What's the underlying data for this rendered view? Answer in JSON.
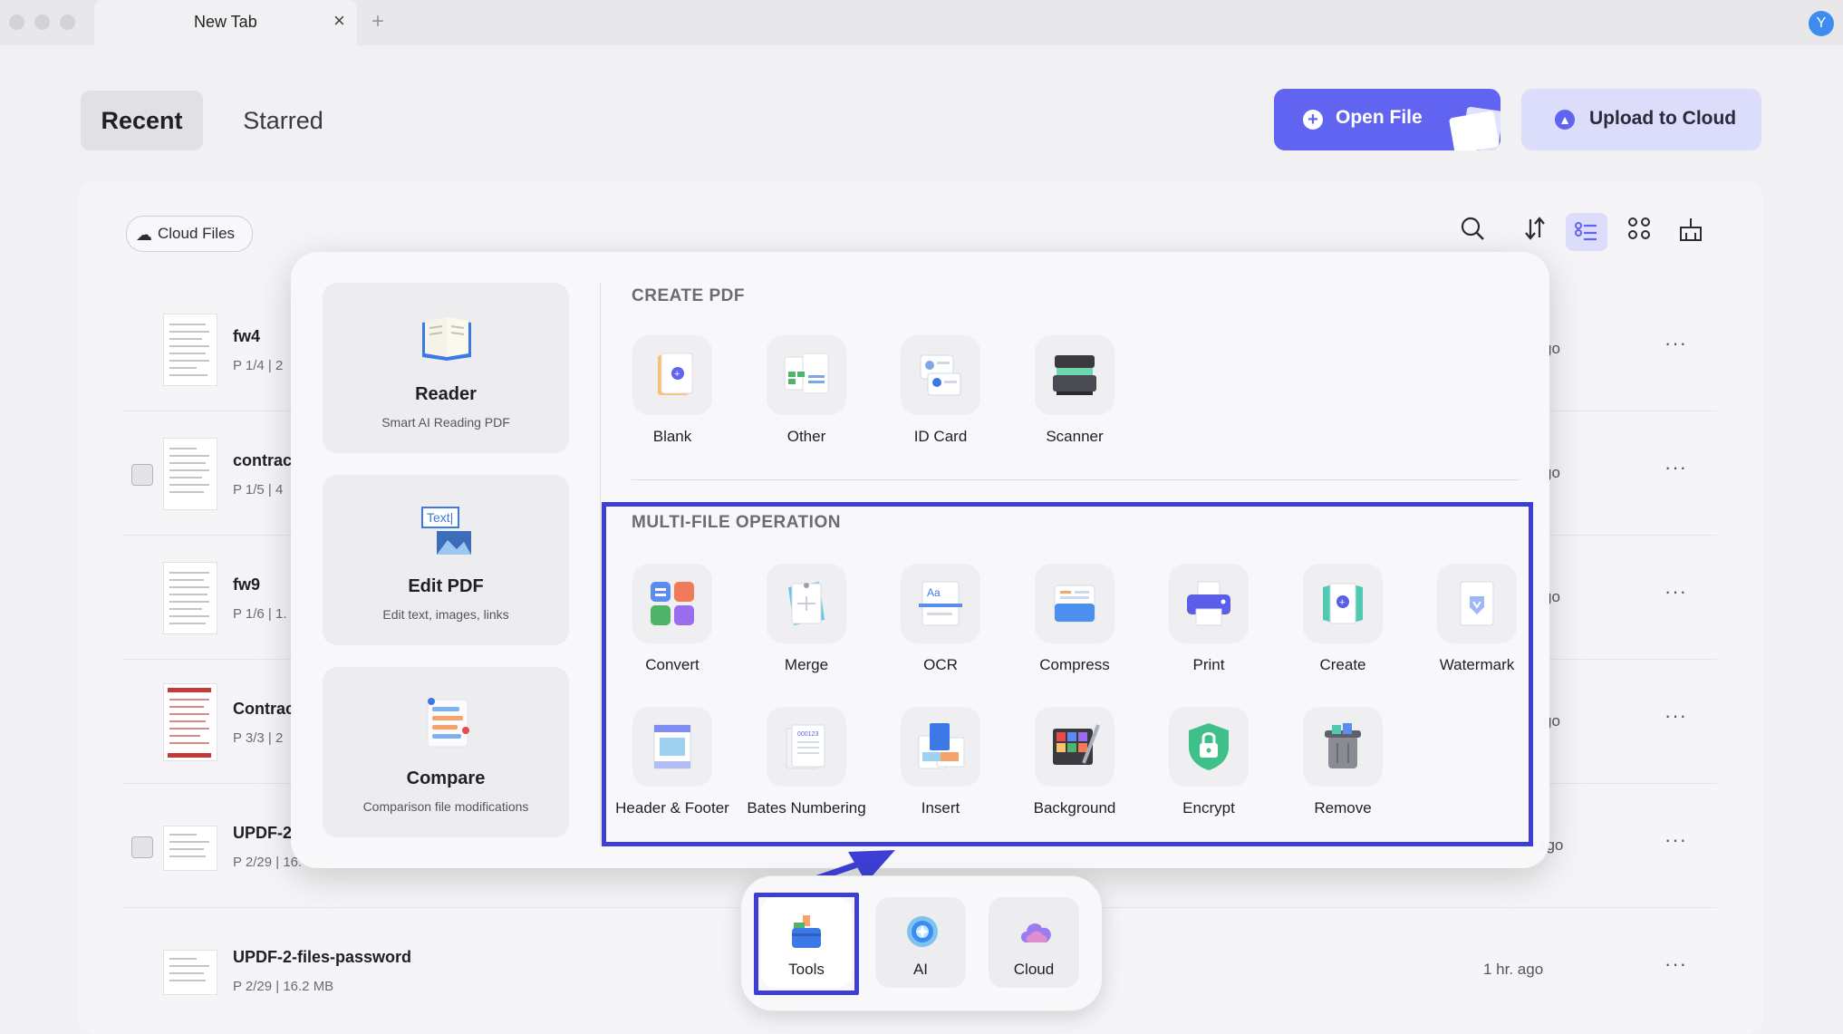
{
  "window": {
    "tab_title": "New Tab",
    "tab_close": "×",
    "new_tab": "+",
    "avatar_letter": "Y"
  },
  "header": {
    "tabs": [
      {
        "label": "Recent",
        "active": true
      },
      {
        "label": "Starred",
        "active": false
      }
    ],
    "open_file": "Open File",
    "upload": "Upload to Cloud"
  },
  "toolbar": {
    "cloud_files": "Cloud Files",
    "icons": [
      "search-icon",
      "sort-icon",
      "list-view-icon",
      "grid-view-icon",
      "clean-icon"
    ]
  },
  "files": [
    {
      "name": "fw4",
      "meta": "P 1/4 | 2",
      "time": "go"
    },
    {
      "name": "contrac",
      "meta": "P 1/5 | 4",
      "time": "go"
    },
    {
      "name": "fw9",
      "meta": "P 1/6 | 1.",
      "time": "go"
    },
    {
      "name": "Contrac",
      "meta": "P 3/3 | 2",
      "time": "go"
    },
    {
      "name": "UPDF-2",
      "meta": "P 2/29 | 16.",
      "time": "ago"
    },
    {
      "name": "UPDF-2-files-password",
      "meta": "P 2/29 | 16.2 MB",
      "time": "1 hr. ago"
    }
  ],
  "popup": {
    "cards": [
      {
        "title": "Reader",
        "subtitle": "Smart AI Reading PDF"
      },
      {
        "title": "Edit PDF",
        "subtitle": "Edit text, images, links"
      },
      {
        "title": "Compare",
        "subtitle": "Comparison file modifications"
      }
    ],
    "create_title": "CREATE PDF",
    "create_items": [
      "Blank",
      "Other",
      "ID Card",
      "Scanner"
    ],
    "multi_title": "MULTI-FILE OPERATION",
    "multi_items": [
      "Convert",
      "Merge",
      "OCR",
      "Compress",
      "Print",
      "Create",
      "Watermark",
      "Header & Footer",
      "Bates Numbering",
      "Insert",
      "Background",
      "Encrypt",
      "Remove"
    ]
  },
  "dock": {
    "items": [
      {
        "label": "Tools",
        "selected": true
      },
      {
        "label": "AI",
        "selected": false
      },
      {
        "label": "Cloud",
        "selected": false
      }
    ]
  },
  "colors": {
    "accent": "#6164f0",
    "highlight": "#3d3fd4"
  }
}
